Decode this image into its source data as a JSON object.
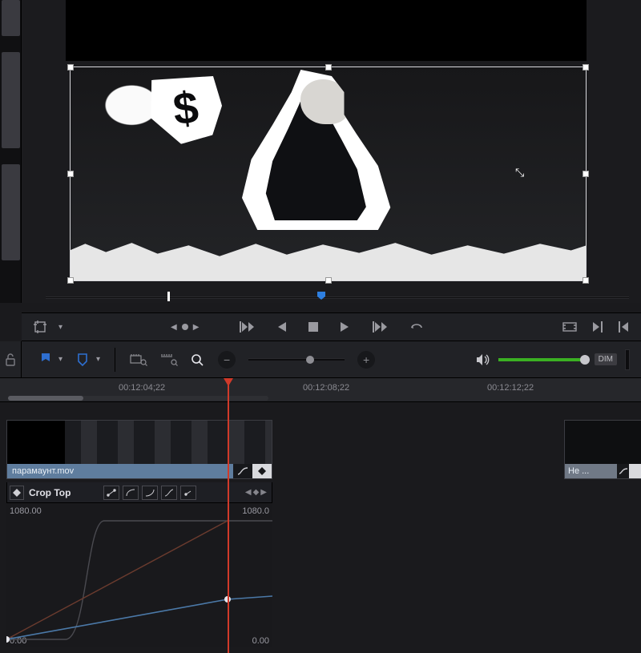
{
  "timeline": {
    "timecodes": [
      "00:12:04;22",
      "00:12:08;22",
      "00:12:12;22"
    ],
    "clip_name": "парамаунт.mov",
    "next_clip_label": "Не ...",
    "crop_param": "Crop Top",
    "value_max": "1080.00",
    "value_end": "1080.0",
    "value_min": "0.00",
    "value_min_right": "0.00"
  },
  "volume": {
    "dim_label": "DIM"
  }
}
